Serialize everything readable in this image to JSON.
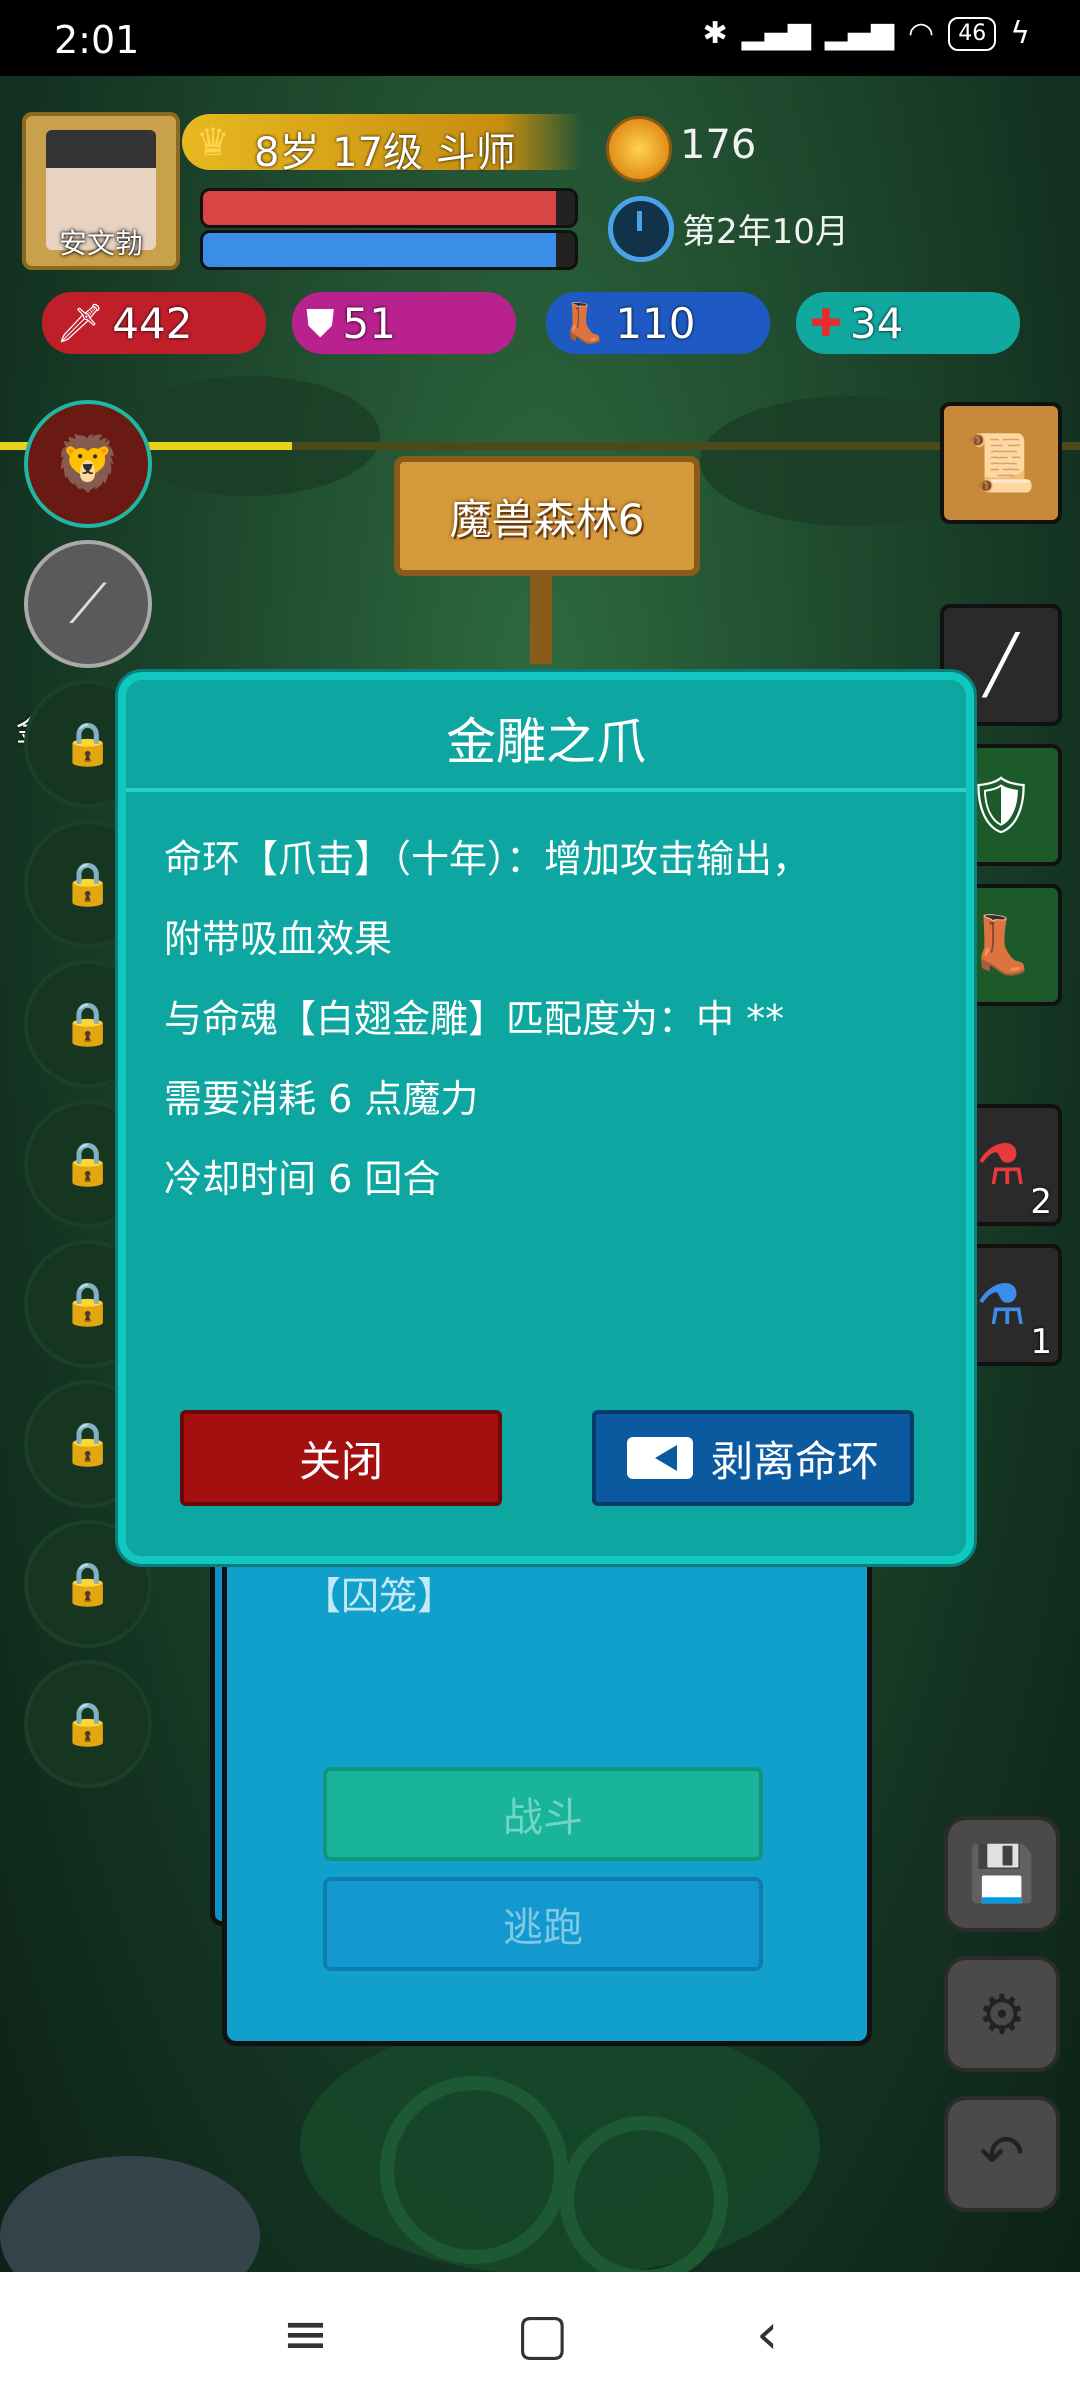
{
  "status_bar": {
    "time": "2:01",
    "battery": "46",
    "icons": [
      "bluetooth-icon",
      "signal-icon",
      "signal-icon",
      "wifi-icon",
      "battery-icon",
      "charging-icon"
    ]
  },
  "player": {
    "name": "安文勃",
    "level_text": "8岁 17级 斗师",
    "hp_fraction": 0.95,
    "mp_fraction": 0.95,
    "gold": "176",
    "date": "第2年10月",
    "xp_fraction": 0.27
  },
  "stats": {
    "attack": "442",
    "defense": "51",
    "speed": "110",
    "heal": "34"
  },
  "location": {
    "name": "魔兽森林6"
  },
  "skills": {
    "slot2_label": "金雕之"
  },
  "items": {
    "red_potion_count": "2",
    "blue_potion_count": "1"
  },
  "battle_card": {
    "enemy_tag": "【囚笼】",
    "fight_label": "战斗",
    "flee_label": "逃跑"
  },
  "dialog": {
    "title": "金雕之爪",
    "line1": "命环【爪击】（十年）：增加攻击输出，",
    "line2": "附带吸血效果",
    "line3": "与命魂【白翅金雕】匹配度为：中 **",
    "line4": "需要消耗 6 点魔力",
    "line5": "冷却时间 6 回合",
    "close_label": "关闭",
    "strip_label": "剥离命环"
  },
  "colors": {
    "dialog_bg": "#0da6a0",
    "close_btn": "#a40f10",
    "strip_btn": "#0b5aa0",
    "hp": "#d84545",
    "mp": "#3a8ee8"
  }
}
